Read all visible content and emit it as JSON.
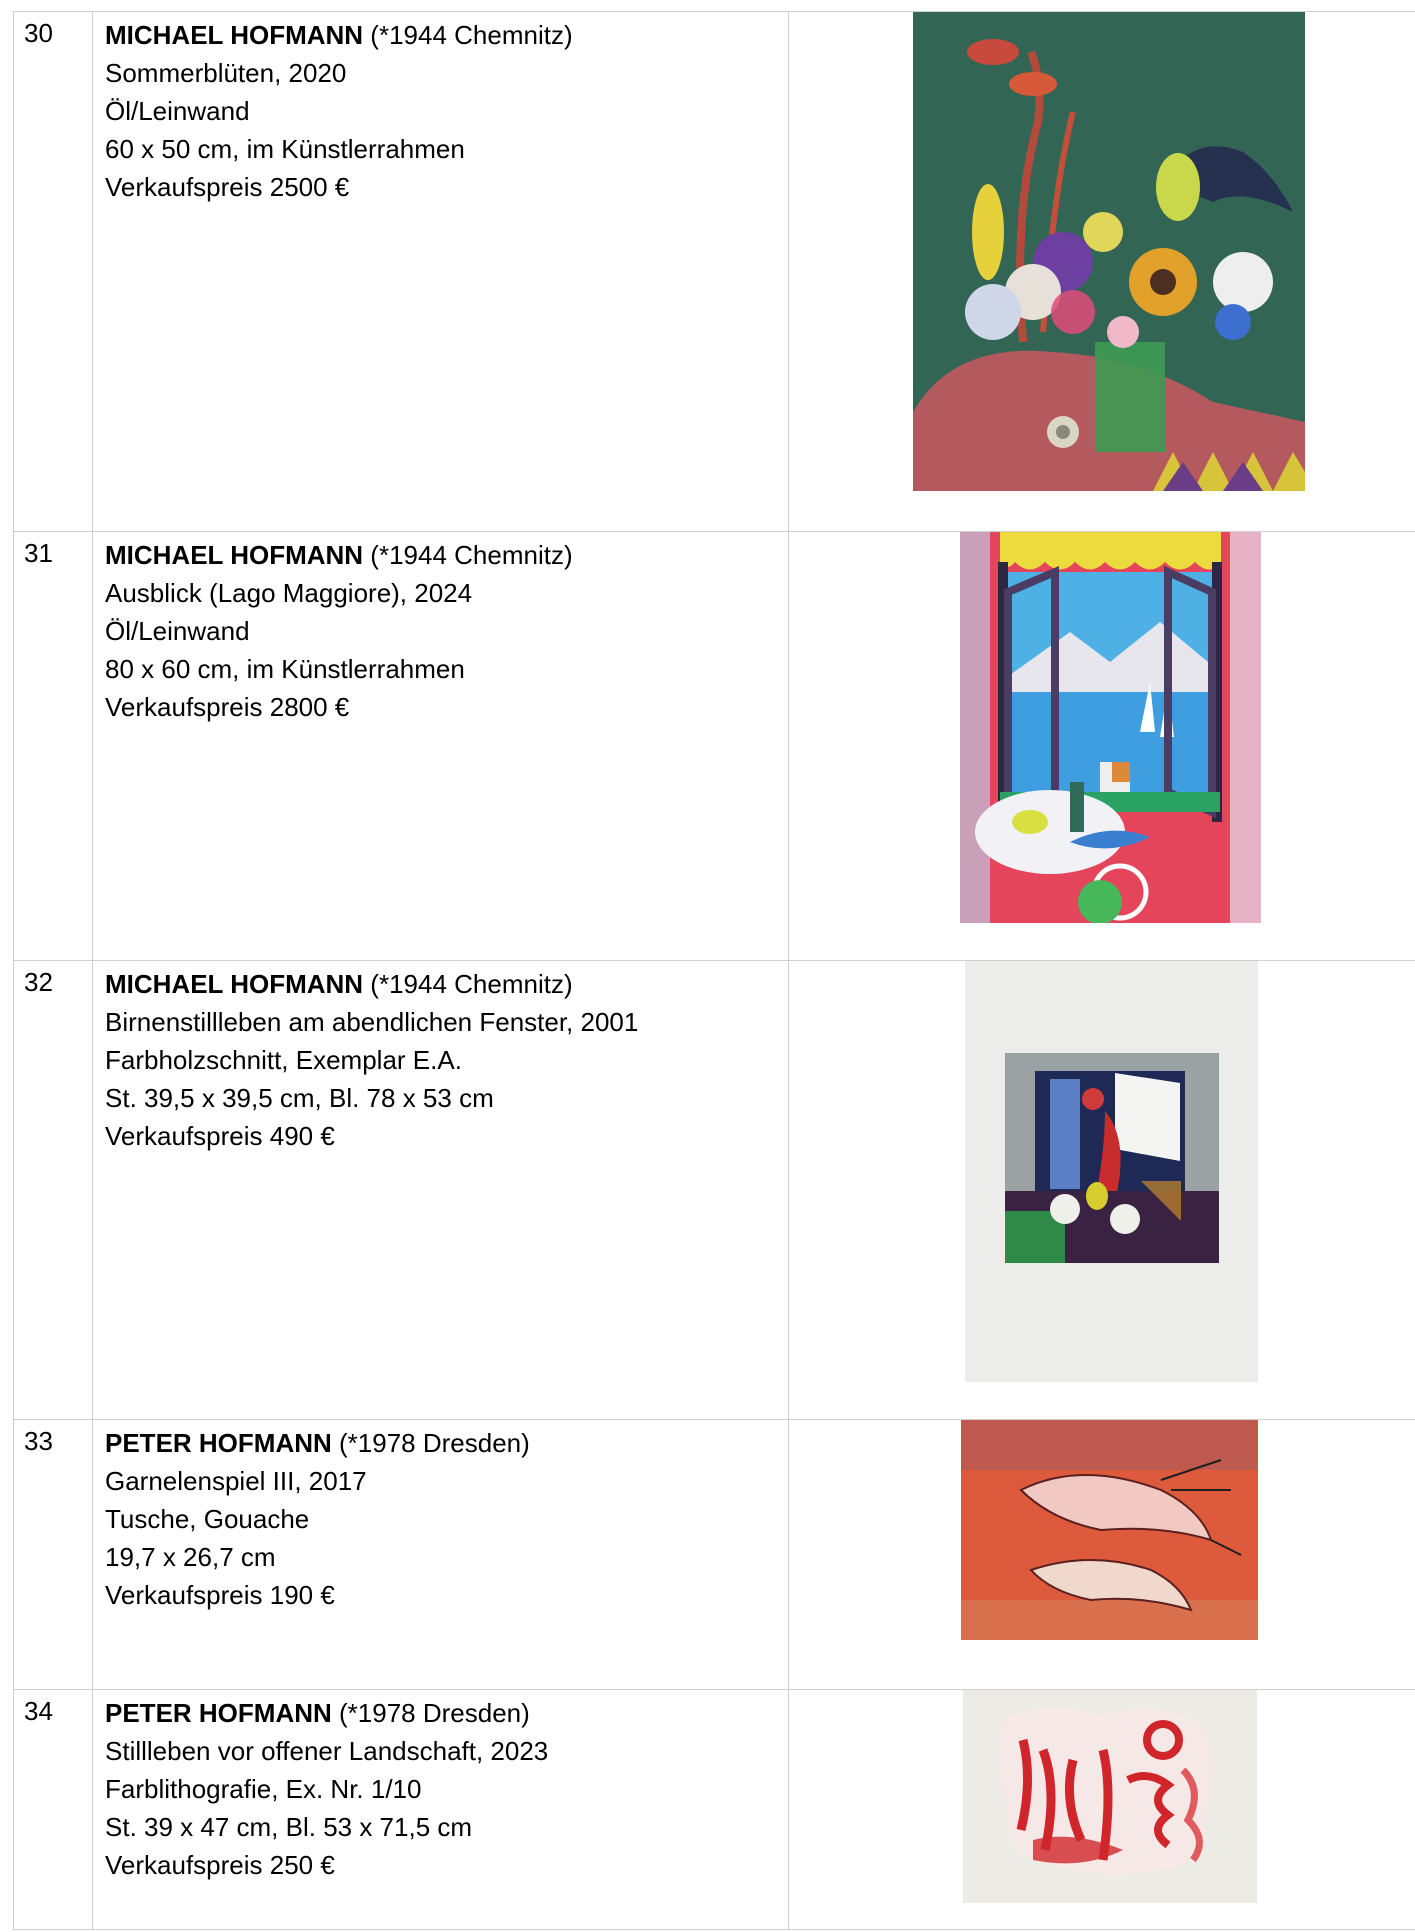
{
  "entries": [
    {
      "number": "30",
      "artist": "MICHAEL HOFMANN",
      "life": "(*1944 Chemnitz)",
      "title": "Sommerblüten, 2020",
      "technique": "Öl/Leinwand",
      "size": "60 x 50 cm, im Künstlerrahmen",
      "price": "Verkaufspreis 2500 €"
    },
    {
      "number": "31",
      "artist": "MICHAEL HOFMANN",
      "life": "(*1944 Chemnitz)",
      "title": "Ausblick (Lago Maggiore), 2024",
      "technique": "Öl/Leinwand",
      "size": "80 x 60 cm, im Künstlerrahmen",
      "price": "Verkaufspreis 2800 €"
    },
    {
      "number": "32",
      "artist": "MICHAEL HOFMANN",
      "life": "(*1944 Chemnitz)",
      "title": "Birnenstillleben am abendlichen Fenster, 2001",
      "technique": "Farbholzschnitt, Exemplar E.A.",
      "size": "St. 39,5 x 39,5 cm, Bl. 78 x 53 cm",
      "price": "Verkaufspreis 490 €"
    },
    {
      "number": "33",
      "artist": "PETER HOFMANN",
      "life": "(*1978 Dresden)",
      "title": "Garnelenspiel III, 2017",
      "technique": "Tusche, Gouache",
      "size": "19,7 x 26,7 cm",
      "price": "Verkaufspreis 190 €"
    },
    {
      "number": "34",
      "artist": "PETER HOFMANN",
      "life": "(*1978 Dresden)",
      "title": "Stillleben vor offener Landschaft, 2023",
      "technique": "Farblithografie, Ex. Nr. 1/10",
      "size": "St. 39 x 47 cm, Bl. 53 x 71,5 cm",
      "price": "Verkaufspreis 250 €"
    }
  ]
}
